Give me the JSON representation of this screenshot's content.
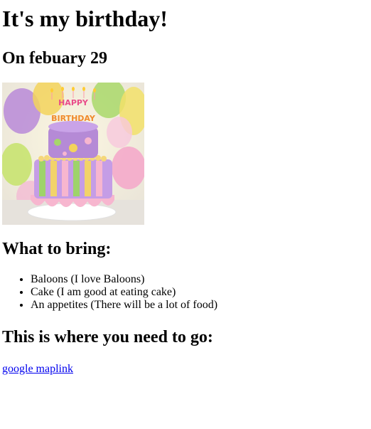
{
  "page": {
    "title": "It's my birthday!",
    "date": "On febuary 29"
  },
  "image": {
    "description_icon": "birthday-cake-icon",
    "topper_text": "HAPPY BIRTHDAY"
  },
  "bring": {
    "heading": "What to bring:",
    "items": [
      "Baloons (I love Baloons)",
      "Cake (I am good at eating cake)",
      "An appetites (There will be a lot of food)"
    ]
  },
  "directions": {
    "heading": "This is where you need to go:",
    "link_label": "google maplink"
  }
}
